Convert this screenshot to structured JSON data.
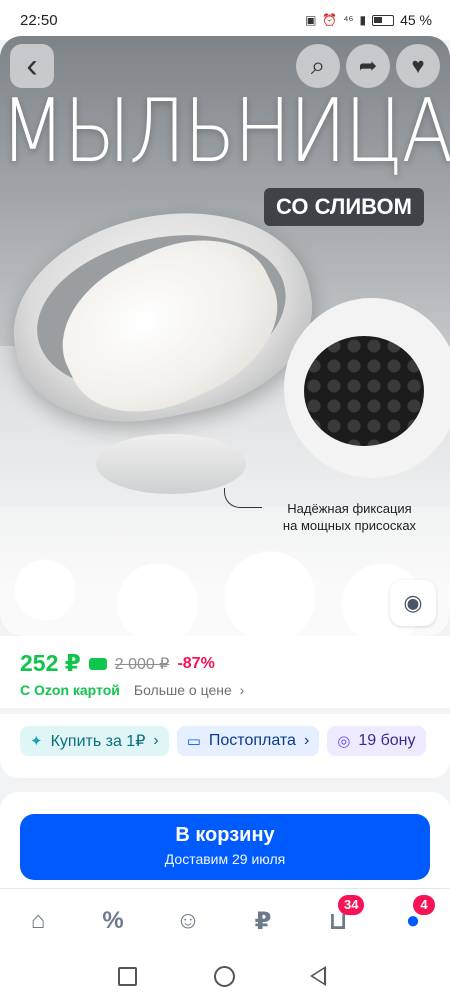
{
  "status_bar": {
    "time": "22:50",
    "network": "⁴⁶",
    "battery": "45 %"
  },
  "hero": {
    "title": "МЫЛЬНИЦА",
    "badge": "СО СЛИВОМ",
    "caption_line1": "Надёжная фиксация",
    "caption_line2": "на мощных присосках",
    "buttons": {
      "back_icon": "‹",
      "search_icon": "⌕",
      "share_icon": "➦",
      "favorite_icon": "♥",
      "image_search_icon": "◉"
    }
  },
  "price": {
    "current": "252 ₽",
    "old": "2 000 ₽",
    "discount": "-87%",
    "ozon_card": "С Ozon картой",
    "more": "Больше о цене",
    "more_chevron": "›"
  },
  "chips": [
    {
      "icon": "✦",
      "label": "Купить за 1₽",
      "chevron": "›"
    },
    {
      "icon": "▭",
      "label": "Постоплата",
      "chevron": "›"
    },
    {
      "icon": "◎",
      "label": "19 бону"
    }
  ],
  "cart": {
    "title": "В корзину",
    "subtitle": "Доставим 29 июля"
  },
  "bottom_nav": [
    {
      "name": "home",
      "icon": "⌂"
    },
    {
      "name": "promo",
      "icon": "%"
    },
    {
      "name": "fresh",
      "icon": "☺"
    },
    {
      "name": "finance",
      "icon": "₽"
    },
    {
      "name": "cart",
      "icon": "⊔",
      "badge": "34"
    },
    {
      "name": "profile",
      "icon": "●",
      "badge": "4"
    }
  ],
  "colors": {
    "accent": "#005bff",
    "price_green": "#10c44c",
    "discount_red": "#f91155"
  }
}
